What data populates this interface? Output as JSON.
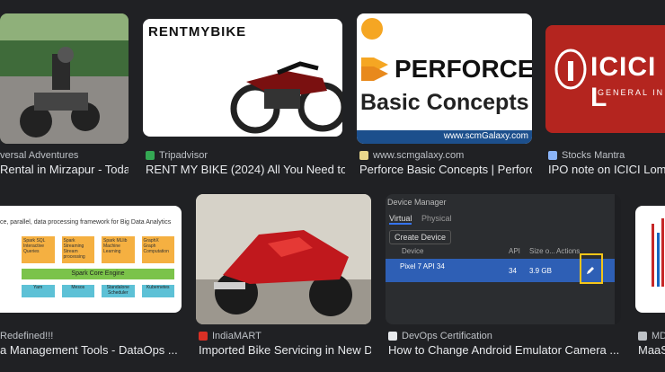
{
  "results": [
    {
      "source": "versal Adventures",
      "title": "Rental in Mirzapur - Toda..."
    },
    {
      "source": "Tripadvisor",
      "title": "RENT MY BIKE (2024) All You Need to ..."
    },
    {
      "source": "www.scmgalaxy.com",
      "title": "Perforce Basic Concepts | Perforc..."
    },
    {
      "source": "Stocks Mantra",
      "title": "IPO note on ICICI Lomba"
    },
    {
      "source": "Redefined!!!",
      "title": "a Management Tools - DataOps ..."
    },
    {
      "source": "IndiaMART",
      "title": "Imported Bike Servicing in New D..."
    },
    {
      "source": "DevOps Certification",
      "title": "How to Change Android Emulator Camera ..."
    },
    {
      "source": "MD",
      "title": "MaaS"
    }
  ],
  "thumbs": {
    "rentmybike_logo": "RENTMYBIKE",
    "perforce_word": "PERFORCE",
    "perforce_sub": "Basic Concepts",
    "perforce_url": "www.scmGalaxy.com",
    "icici_brand": "ICICI L",
    "icici_tag": "GENERAL IN",
    "spark_title": "ce, parallel, data processing framework for Big Data Analytics",
    "spark_engine": "Spark Core Engine",
    "spark_boxes": [
      "Spark SQL Interactive Queries",
      "Spark Streaming Stream processing",
      "Spark MLlib Machine Learning",
      "GraphX Graph Computation"
    ],
    "spark_bottom": [
      "Yarn",
      "Mesos",
      "Standalone Scheduler",
      "Kubernetes"
    ],
    "dm_header": "Device Manager",
    "dm_tab_virtual": "Virtual",
    "dm_tab_physical": "Physical",
    "dm_create": "Create Device",
    "dm_col_device": "Device",
    "dm_col_api": "API",
    "dm_col_size": "Size o...",
    "dm_col_actions": "Actions",
    "dm_device_name": "Pixel 7 API 34",
    "dm_api": "34",
    "dm_size": "3.9 GB"
  },
  "colors": {
    "bg": "#202124",
    "title": "#e8eaed",
    "source": "#bdc1c6",
    "highlight": "#f5c518"
  }
}
